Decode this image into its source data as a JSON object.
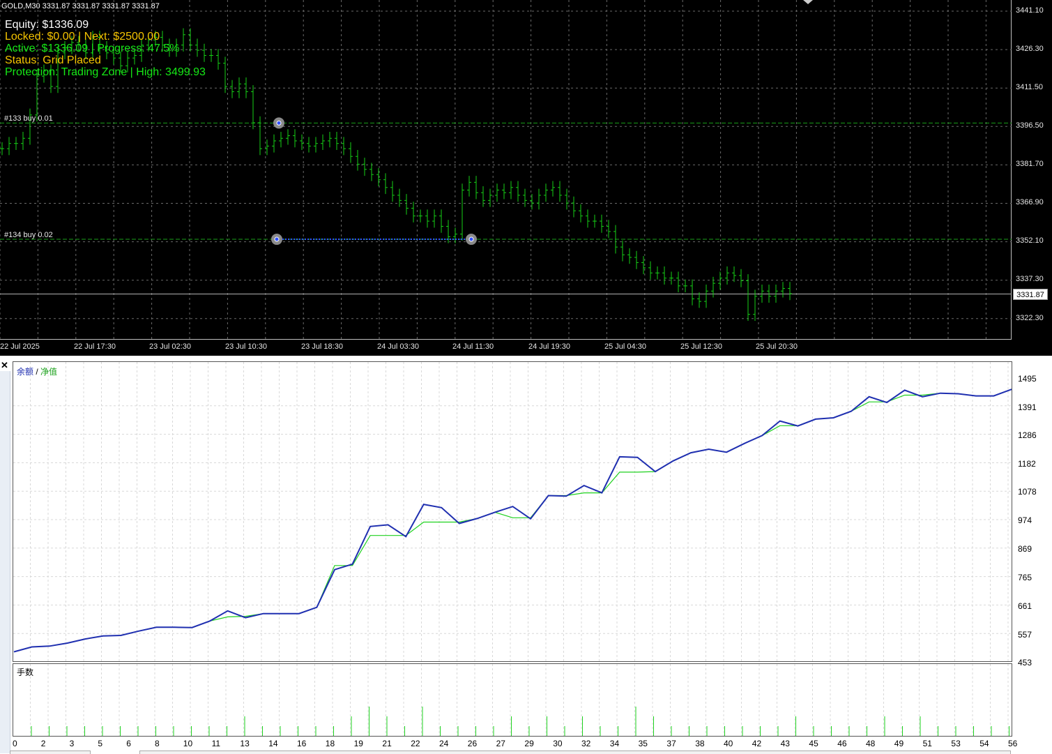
{
  "chart": {
    "symbol_title": "GOLD,M30  3331.87 3331.87 3331.87 3331.87",
    "overlay": {
      "equity": "Equity: $1336.09",
      "locked": "Locked: $0.00 | Next: $2500.00",
      "active": "Active: $1336.09 | Progress: 47.5%",
      "status": "Status: Grid Placed",
      "protection": "Protection: Trading Zone | High: 3499.93"
    },
    "orders": [
      {
        "label": "#133 buy 0.01",
        "price": 3397.9
      },
      {
        "label": "#134 buy 0.02",
        "price": 3353.0
      }
    ],
    "price_axis": [
      "3441.10",
      "3426.30",
      "3411.50",
      "3396.50",
      "3381.70",
      "3366.90",
      "3352.10",
      "3337.30",
      "3322.30"
    ],
    "current_price": "3331.87",
    "time_axis": [
      "22 Jul 2025",
      "22 Jul 17:30",
      "23 Jul 02:30",
      "23 Jul 10:30",
      "23 Jul 18:30",
      "24 Jul 03:30",
      "24 Jul 11:30",
      "24 Jul 19:30",
      "25 Jul 04:30",
      "25 Jul 12:30",
      "25 Jul 20:30"
    ],
    "colors": {
      "bars": "#16d016",
      "grid": "#6a6a6a",
      "order_line": "#1aa01a",
      "trade_link": "#2f4fff"
    }
  },
  "tester": {
    "close_icon": "close-icon",
    "legend": {
      "balance": "余额",
      "sep": " / ",
      "equity": "净值"
    },
    "volume_title": "手数",
    "y_axis": [
      "1495",
      "1391",
      "1286",
      "1182",
      "1078",
      "974",
      "869",
      "765",
      "661",
      "557",
      "453"
    ],
    "x_axis": [
      "0",
      "2",
      "3",
      "5",
      "6",
      "8",
      "10",
      "11",
      "13",
      "14",
      "16",
      "18",
      "19",
      "21",
      "22",
      "24",
      "26",
      "27",
      "29",
      "30",
      "32",
      "34",
      "35",
      "37",
      "38",
      "40",
      "42",
      "43",
      "45",
      "46",
      "48",
      "49",
      "51",
      "53",
      "54",
      "56"
    ]
  },
  "chart_data": [
    {
      "type": "line",
      "title": "",
      "legend": [
        "余额",
        "净值"
      ],
      "ylim": [
        453,
        1495
      ],
      "series": [
        {
          "name": "余额",
          "color": "#1f2fb0",
          "values": [
            490,
            508,
            511,
            522,
            537,
            548,
            550,
            566,
            580,
            580,
            579,
            603,
            640,
            615,
            630,
            630,
            630,
            653,
            791,
            811,
            949,
            955,
            912,
            1030,
            1018,
            960,
            978,
            1001,
            1022,
            977,
            1062,
            1060,
            1099,
            1072,
            1204,
            1202,
            1150,
            1189,
            1219,
            1232,
            1221,
            1253,
            1282,
            1335,
            1317,
            1342,
            1347,
            1371,
            1424,
            1403,
            1448,
            1424,
            1437,
            1435,
            1427,
            1427,
            1451
          ]
        },
        {
          "name": "净值",
          "color": "#1ed11e",
          "values": [
            490,
            508,
            511,
            522,
            537,
            548,
            550,
            566,
            580,
            580,
            579,
            603,
            618,
            620,
            630,
            630,
            630,
            653,
            806,
            806,
            916,
            916,
            916,
            965,
            965,
            965,
            978,
            1001,
            981,
            981,
            1062,
            1062,
            1072,
            1072,
            1148,
            1148,
            1150,
            1189,
            1219,
            1232,
            1221,
            1253,
            1282,
            1318,
            1318,
            1342,
            1347,
            1371,
            1405,
            1405,
            1430,
            1430,
            1437,
            1435,
            1427,
            1427,
            1451
          ]
        }
      ]
    },
    {
      "type": "bar",
      "title": "手数",
      "series": [
        {
          "name": "手数",
          "values": [
            0.01,
            0.01,
            0.01,
            0.01,
            0.01,
            0.01,
            0.01,
            0.01,
            0.01,
            0.01,
            0.01,
            0.01,
            0.02,
            0.01,
            0.01,
            0.01,
            0.01,
            0.01,
            0.02,
            0.03,
            0.02,
            0.01,
            0.03,
            0.01,
            0.01,
            0.01,
            0.01,
            0.02,
            0.01,
            0.02,
            0.01,
            0.02,
            0.01,
            0.01,
            0.03,
            0.02,
            0.01,
            0.01,
            0.01,
            0.01,
            0.01,
            0.01,
            0.01,
            0.02,
            0.01,
            0.01,
            0.01,
            0.01,
            0.02,
            0.01,
            0.02,
            0.01,
            0.01,
            0.01,
            0.01,
            0.01,
            0.01
          ]
        }
      ]
    },
    {
      "type": "bar",
      "title": "GOLD,M30",
      "ylim": [
        3315,
        3445
      ],
      "series": [
        {
          "name": "GOLD,M30",
          "values": [
            3388,
            3390,
            3390,
            3392,
            3401,
            3416,
            3418,
            3412,
            3425,
            3427,
            3429,
            3428,
            3425,
            3431,
            3427,
            3425,
            3423,
            3420,
            3423,
            3424,
            3428,
            3430,
            3431,
            3428,
            3426,
            3428,
            3432,
            3428,
            3426,
            3424,
            3424,
            3421,
            3412,
            3410,
            3413,
            3410,
            3398,
            3388,
            3389,
            3391,
            3392,
            3393,
            3391,
            3390,
            3389,
            3390,
            3391,
            3392,
            3390,
            3388,
            3385,
            3382,
            3380,
            3378,
            3376,
            3373,
            3370,
            3368,
            3365,
            3362,
            3362,
            3360,
            3362,
            3358,
            3354,
            3355,
            3372,
            3375,
            3371,
            3368,
            3370,
            3372,
            3371,
            3373,
            3370,
            3368,
            3367,
            3370,
            3372,
            3373,
            3370,
            3367,
            3364,
            3362,
            3360,
            3360,
            3358,
            3356,
            3350,
            3347,
            3346,
            3344,
            3342,
            3340,
            3340,
            3338,
            3338,
            3335,
            3335,
            3330,
            3329,
            3333,
            3336,
            3338,
            3340,
            3339,
            3337,
            3324,
            3331,
            3333,
            3331,
            3333,
            3334,
            3332
          ]
        }
      ]
    }
  ]
}
